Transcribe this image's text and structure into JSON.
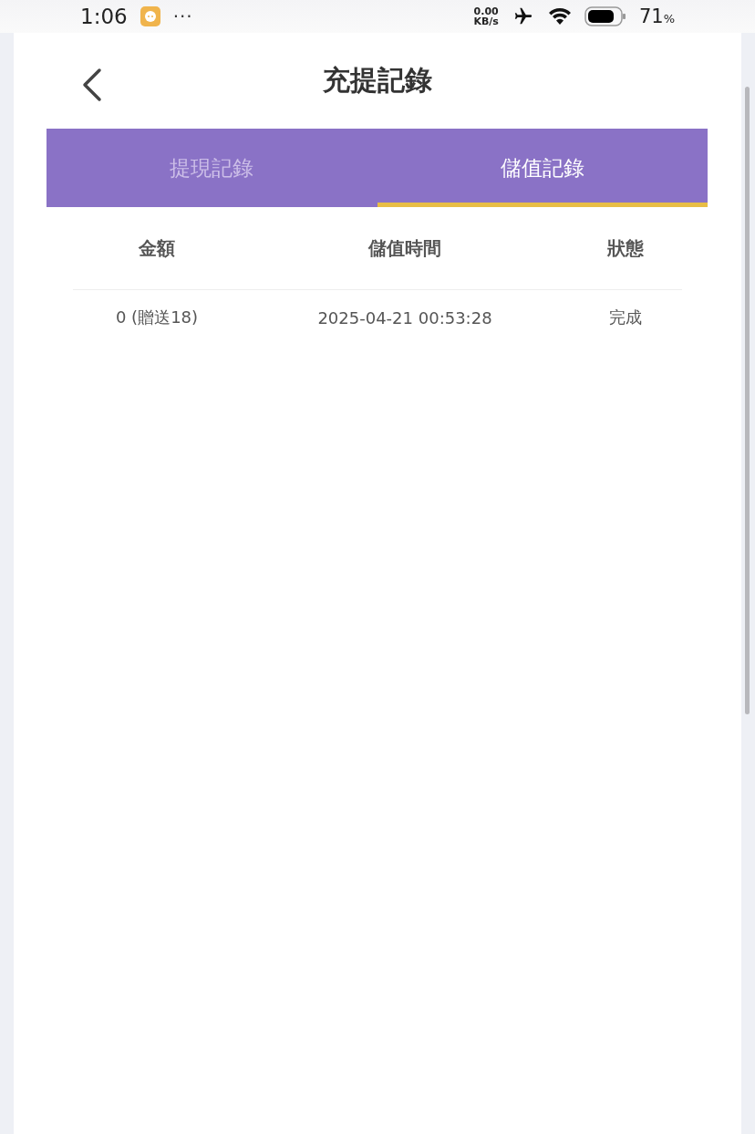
{
  "status_bar": {
    "time": "1:06",
    "more": "···",
    "net_speed_value": "0.00",
    "net_speed_unit": "KB/s",
    "battery": "71",
    "battery_unit": "%"
  },
  "header": {
    "title": "充提記錄"
  },
  "tabs": [
    {
      "label": "提現記錄",
      "selected": false
    },
    {
      "label": "儲值記錄",
      "selected": true
    }
  ],
  "table": {
    "columns": [
      "金額",
      "儲值時間",
      "狀態"
    ],
    "rows": [
      [
        "0 (贈送18)",
        "2025-04-21 00:53:28",
        "完成"
      ]
    ]
  }
}
